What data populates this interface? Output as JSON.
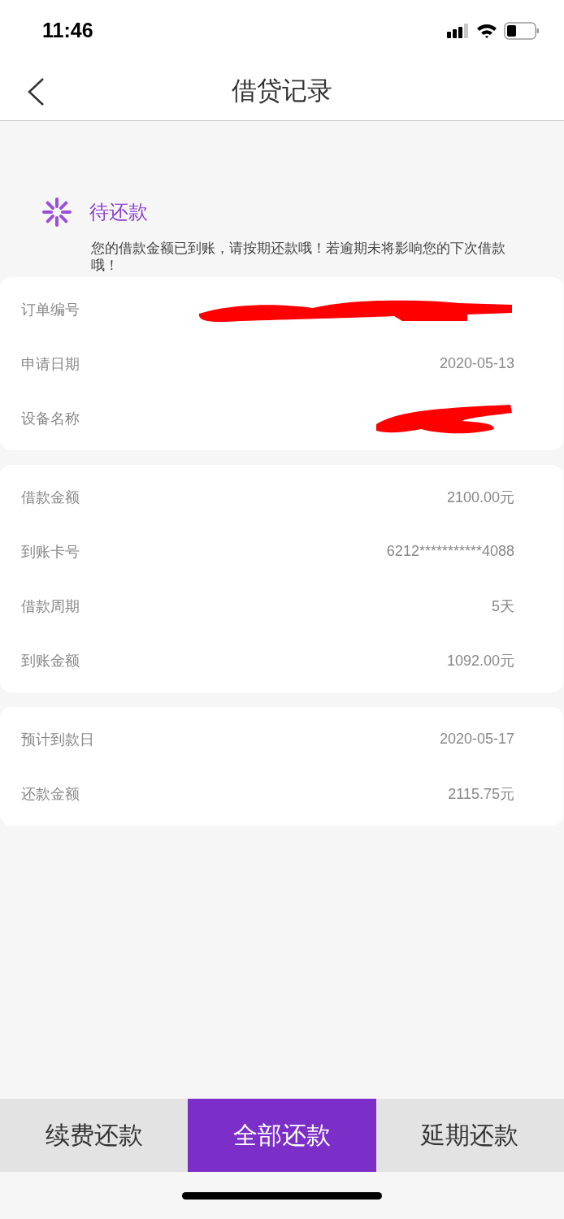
{
  "status_bar": {
    "time": "11:46"
  },
  "nav": {
    "title": "借贷记录"
  },
  "status": {
    "title": "待还款",
    "message": "您的借款金额已到账，请按期还款哦！若逾期未将影响您的下次借款哦！"
  },
  "cards": [
    {
      "rows": [
        {
          "label": "订单编号",
          "kind": "redacted"
        },
        {
          "label": "申请日期",
          "kind": "text",
          "value": "2020-05-13"
        },
        {
          "label": "设备名称",
          "kind": "redacted"
        }
      ]
    },
    {
      "rows": [
        {
          "label": "借款金额",
          "kind": "text",
          "value": "2100.00元"
        },
        {
          "label": "到账卡号",
          "kind": "text",
          "value": "6212***********4088"
        },
        {
          "label": "借款周期",
          "kind": "text",
          "value": "5天"
        },
        {
          "label": "到账金额",
          "kind": "text",
          "value": "1092.00元"
        }
      ]
    },
    {
      "rows": [
        {
          "label": "预计到款日",
          "kind": "text",
          "value": "2020-05-17"
        },
        {
          "label": "还款金额",
          "kind": "text",
          "value": "2115.75元"
        }
      ]
    }
  ],
  "buttons": [
    {
      "label": "续费还款",
      "selected": false
    },
    {
      "label": "全部还款",
      "selected": true
    },
    {
      "label": "延期还款",
      "selected": false
    }
  ]
}
